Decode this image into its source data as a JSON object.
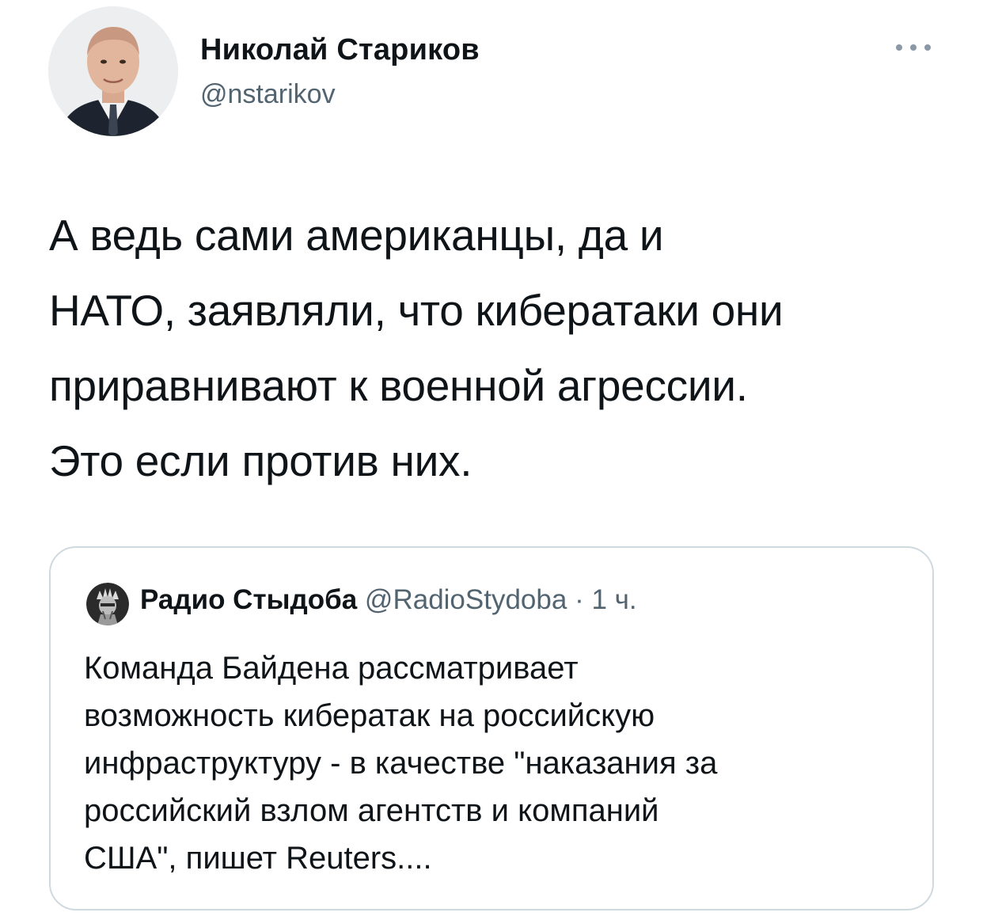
{
  "tweet": {
    "author_name": "Николай Стариков",
    "author_handle": "@nstarikov",
    "more_icon": "more-horizontal-icon",
    "text_lines": [
      "А ведь сами американцы, да и",
      "НАТО, заявляли, что кибератаки они",
      "приравнивают к военной агрессии.",
      "Это если против них."
    ]
  },
  "quote": {
    "author_name": "Радио Стыдоба",
    "author_handle": "@RadioStydoba",
    "separator": " · ",
    "time": "1 ч.",
    "text_lines": [
      "Команда Байдена рассматривает",
      "возможность кибератак на российскую",
      "инфраструктуру - в качестве \"наказания за",
      "российский взлом агентств и компаний",
      "США\", пишет Reuters...."
    ]
  },
  "colors": {
    "text_primary": "#0f1419",
    "text_secondary": "#536471",
    "border": "#cfd9de"
  }
}
